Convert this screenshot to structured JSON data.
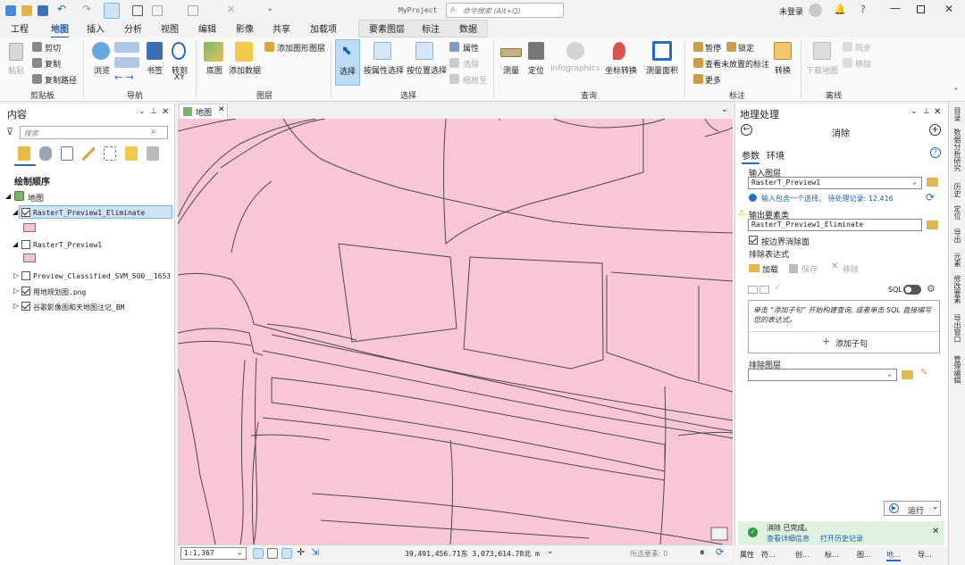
{
  "window": {
    "title": "MyProject",
    "search_placeholder": "命令搜索 (Alt+Q)",
    "user": "未登录"
  },
  "tabs": {
    "project": "工程",
    "map": "地图",
    "insert": "插入",
    "analysis": "分析",
    "view": "视图",
    "edit": "编辑",
    "imagery": "影像",
    "share": "共享",
    "addins": "加载项",
    "feature_layer": "要素图层",
    "labeling": "标注",
    "data": "数据"
  },
  "ribbon": {
    "clipboard": {
      "label": "剪贴板",
      "paste": "粘贴",
      "cut": "剪切",
      "copy": "复制",
      "copy_path": "复制路径"
    },
    "navigate": {
      "label": "导航",
      "explore": "浏览",
      "bookmarks": "书签",
      "goto": "转到",
      "xy": "XY"
    },
    "layer": {
      "label": "图层",
      "basemap": "底图",
      "add_data": "添加数据",
      "add_graphics": "添加图形图层"
    },
    "selection": {
      "label": "选择",
      "select": "选择",
      "by_attr": "按属性选择",
      "by_loc": "按位置选择",
      "attributes": "属性",
      "clear": "清除",
      "zoom_to": "缩放至"
    },
    "inquiry": {
      "label": "查询",
      "measure": "测量",
      "locate": "定位",
      "infographics": "Infographics",
      "coord_convert": "坐标转换",
      "measure_area": "测量面积"
    },
    "labeling": {
      "label": "标注",
      "pause": "暂停",
      "lock": "锁定",
      "view_unplaced": "查看未放置的标注",
      "more": "更多",
      "convert": "转换"
    },
    "offline": {
      "label": "离线",
      "download_map": "下载地图",
      "sync": "同步",
      "remove": "移除"
    }
  },
  "contents": {
    "title": "内容",
    "search_placeholder": "搜索",
    "drawing_order": "绘制顺序",
    "map_node": "地图",
    "layers": [
      {
        "name": "RasterT_Preview1_Eliminate",
        "checked": true
      },
      {
        "name": "RasterT_Preview1",
        "checked": false
      },
      {
        "name": "Preview_Classified_SVM_500__1653",
        "checked": false
      },
      {
        "name": "用地规划图.png",
        "checked": true
      },
      {
        "name": "谷歌影像图和天地图注记_BM",
        "checked": true
      }
    ],
    "swatch_color": "#f7c3d4"
  },
  "map_view": {
    "tab": "地图",
    "fill_color": "#f9c6d7",
    "line_color": "#4a4a4a"
  },
  "status_bar": {
    "scale": "1:1,367",
    "coords": "39,491,456.71东 3,073,614.78北 m",
    "selected": "所选要素: 0"
  },
  "geoprocessing": {
    "title": "地理处理",
    "tool": "消除",
    "tab_params": "参数",
    "tab_env": "环境",
    "input_layer_label": "输入图层",
    "input_layer_value": "RasterT_Preview1",
    "info_text": "输入包含一个选择。 待处理记录: 12,416",
    "output_label": "输出要素类",
    "output_value": "RasterT_Preview1_Eliminate",
    "boundary_check": "按边界消除面",
    "expr_label": "排除表达式",
    "load": "加载",
    "save": "保存",
    "remove": "移除",
    "sql": "SQL",
    "hint": "单击 “添加子句” 开始构建查询, 或者单击 SQL 直接编写您的表达式。",
    "add_clause": "添加子句",
    "exclude_layer_label": "排除图层",
    "run": "运行",
    "done_title": "消除 已完成。",
    "view_details": "查看详细信息",
    "open_history": "打开历史记录"
  },
  "side_tabs": [
    "目录",
    "数据分析研究",
    "历史",
    "定位",
    "导出",
    "元素",
    "修改要素",
    "导出窗口",
    "管理编辑"
  ],
  "bottom_tabs": [
    "属性",
    "符...",
    "创...",
    "标...",
    "图...",
    "地...",
    "导..."
  ]
}
